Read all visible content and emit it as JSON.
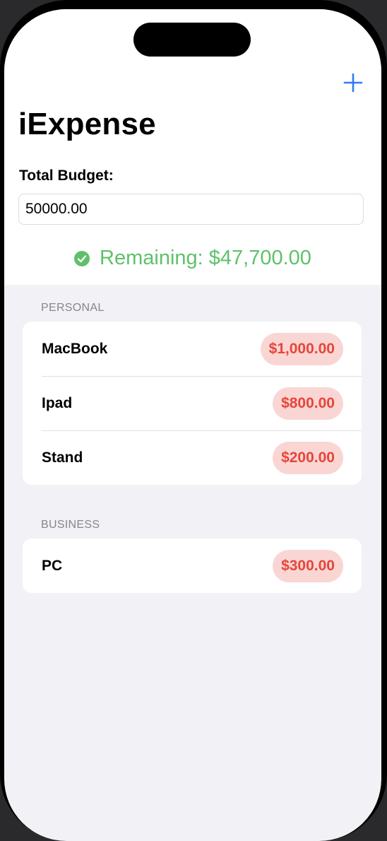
{
  "nav": {
    "add_icon": "plus-icon",
    "accent": "#2f7bf5"
  },
  "title": "iExpense",
  "budget": {
    "label": "Total Budget:",
    "value": "50000.00"
  },
  "remaining": {
    "icon": "checkmark-circle-icon",
    "text": "Remaining: $47,700.00",
    "color": "#5ec16a"
  },
  "sections": [
    {
      "header": "PERSONAL",
      "items": [
        {
          "name": "MacBook",
          "amount": "$1,000.00"
        },
        {
          "name": "Ipad",
          "amount": "$800.00"
        },
        {
          "name": "Stand",
          "amount": "$200.00"
        }
      ]
    },
    {
      "header": "BUSINESS",
      "items": [
        {
          "name": "PC",
          "amount": "$300.00"
        }
      ]
    }
  ],
  "colors": {
    "amount_text": "#e6453a",
    "amount_bg": "#f9d6d4",
    "list_bg": "#f2f1f6"
  }
}
